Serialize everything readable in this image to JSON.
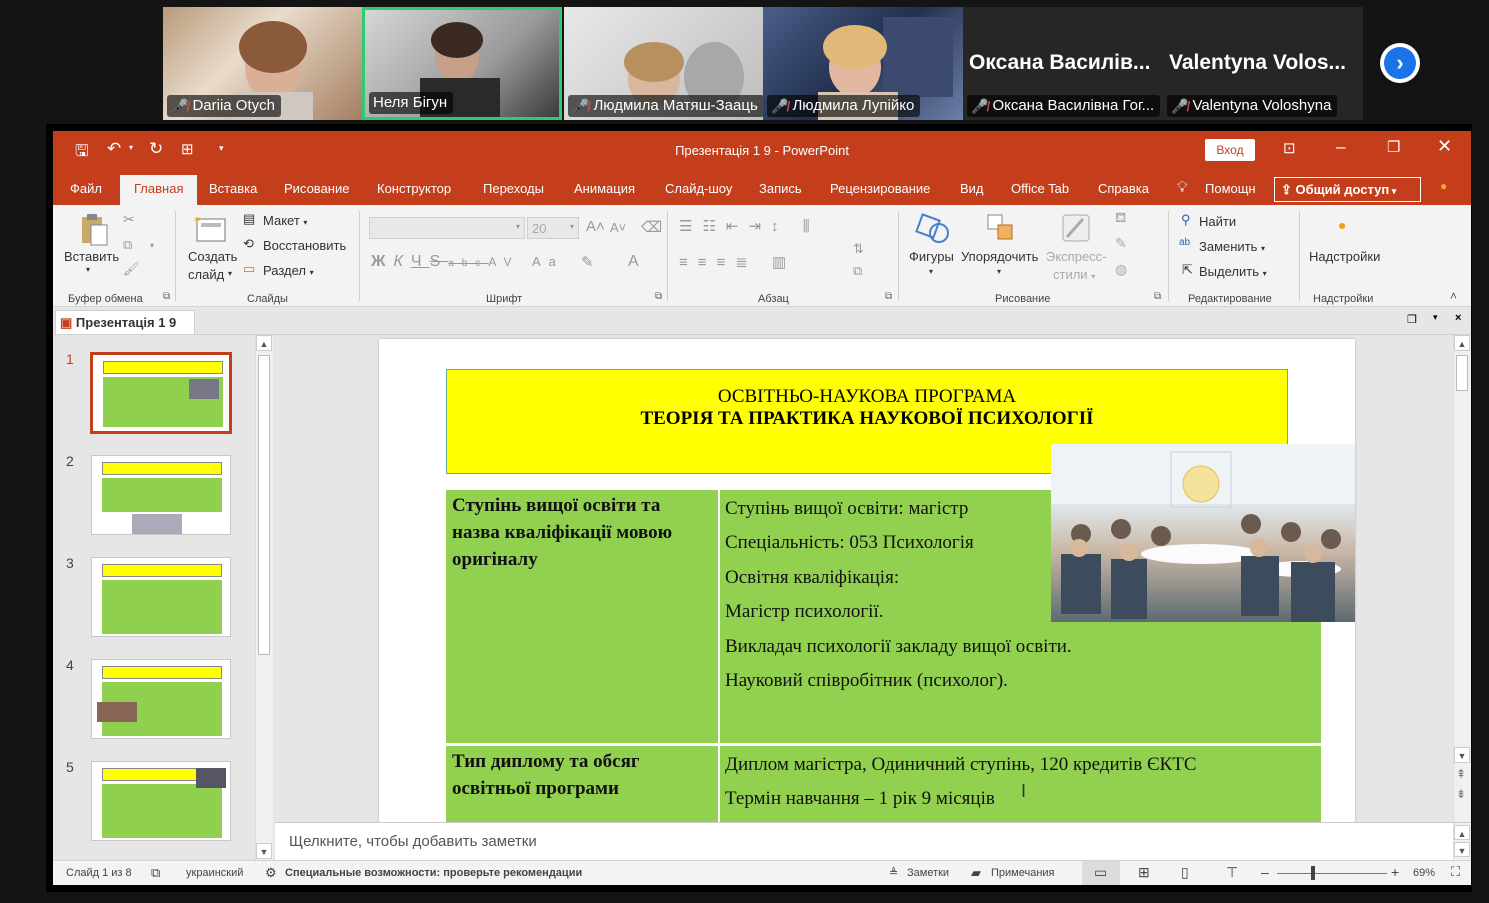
{
  "meeting": {
    "participants": [
      {
        "name": "Dariia Otych",
        "muted": true
      },
      {
        "name": "Неля Бігун",
        "muted": false
      },
      {
        "name": "Людмила Матяш-Зааць",
        "muted": true
      },
      {
        "name": "Людмила Лупійко",
        "muted": true
      },
      {
        "name": "Оксана Василівна Гог...",
        "display": "Оксана  Василів...",
        "muted": true
      },
      {
        "name": "Valentyna Voloshyna",
        "display": "Valentyna  Volos...",
        "muted": true
      }
    ],
    "colors": {
      "active_speaker": "#2ecc71",
      "next_button": "#1a73e8"
    }
  },
  "app": {
    "title": "Презентація 1 9  -  PowerPoint",
    "login_label": "Вход",
    "accent": "#c43e1c",
    "tabs": [
      "Файл",
      "Главная",
      "Вставка",
      "Рисование",
      "Конструктор",
      "Переходы",
      "Анимация",
      "Слайд-шоу",
      "Запись",
      "Рецензирование",
      "Вид",
      "Office Tab",
      "Справка"
    ],
    "help_label": "Помощн",
    "share_label": "Общий доступ",
    "ribbon": {
      "paste": "Вставить",
      "new_slide": "Создать",
      "new_slide2": "слайд",
      "layout": "Макет",
      "reset": "Восстановить",
      "section": "Раздел",
      "font_size": "20",
      "shapes": "Фигуры",
      "arrange": "Упорядочить",
      "quick_styles": "Экспресс-",
      "quick_styles2": "стили",
      "find": "Найти",
      "replace": "Заменить",
      "select": "Выделить",
      "addins": "Надстройки",
      "groups": [
        "Буфер обмена",
        "Слайды",
        "Шрифт",
        "Абзац",
        "Рисование",
        "Редактирование",
        "Надстройки"
      ]
    },
    "doc_tab": "Презентація 1 9",
    "thumbnails": [
      "1",
      "2",
      "3",
      "4",
      "5"
    ],
    "notes_placeholder": "Щелкните, чтобы добавить заметки",
    "status": {
      "slide": "Слайд 1 из 8",
      "language": "украинский",
      "accessibility": "Специальные возможности: проверьте рекомендации",
      "notes": "Заметки",
      "comments": "Примечания",
      "zoom": "69%"
    }
  },
  "slide": {
    "title_line1": "ОСВІТНЬО-НАУКОВА ПРОГРАМА",
    "title_line2": "ТЕОРІЯ ТА ПРАКТИКА НАУКОВОЇ ПСИХОЛОГІЇ",
    "row1_label": "Ступінь вищої освіти та назва кваліфікації мовою оригіналу",
    "row1_lines": [
      "Ступінь вищої освіти: магістр",
      "Спеціальність: 053 Психологія",
      "Освітня кваліфікація:",
      "Магістр психології.",
      "Викладач психології закладу вищої освіти.",
      "Науковий співробітник (психолог)."
    ],
    "row2_label": "Тип диплому та обсяг освітньої програми",
    "row2_lines": [
      "Диплом магістра, Одиничний ступінь, 120 кредитів ЄКТС",
      "Термін  навчання – 1 рік 9 місяців"
    ],
    "colors": {
      "title_bg": "#ffff00",
      "table_bg": "#92d050"
    }
  }
}
